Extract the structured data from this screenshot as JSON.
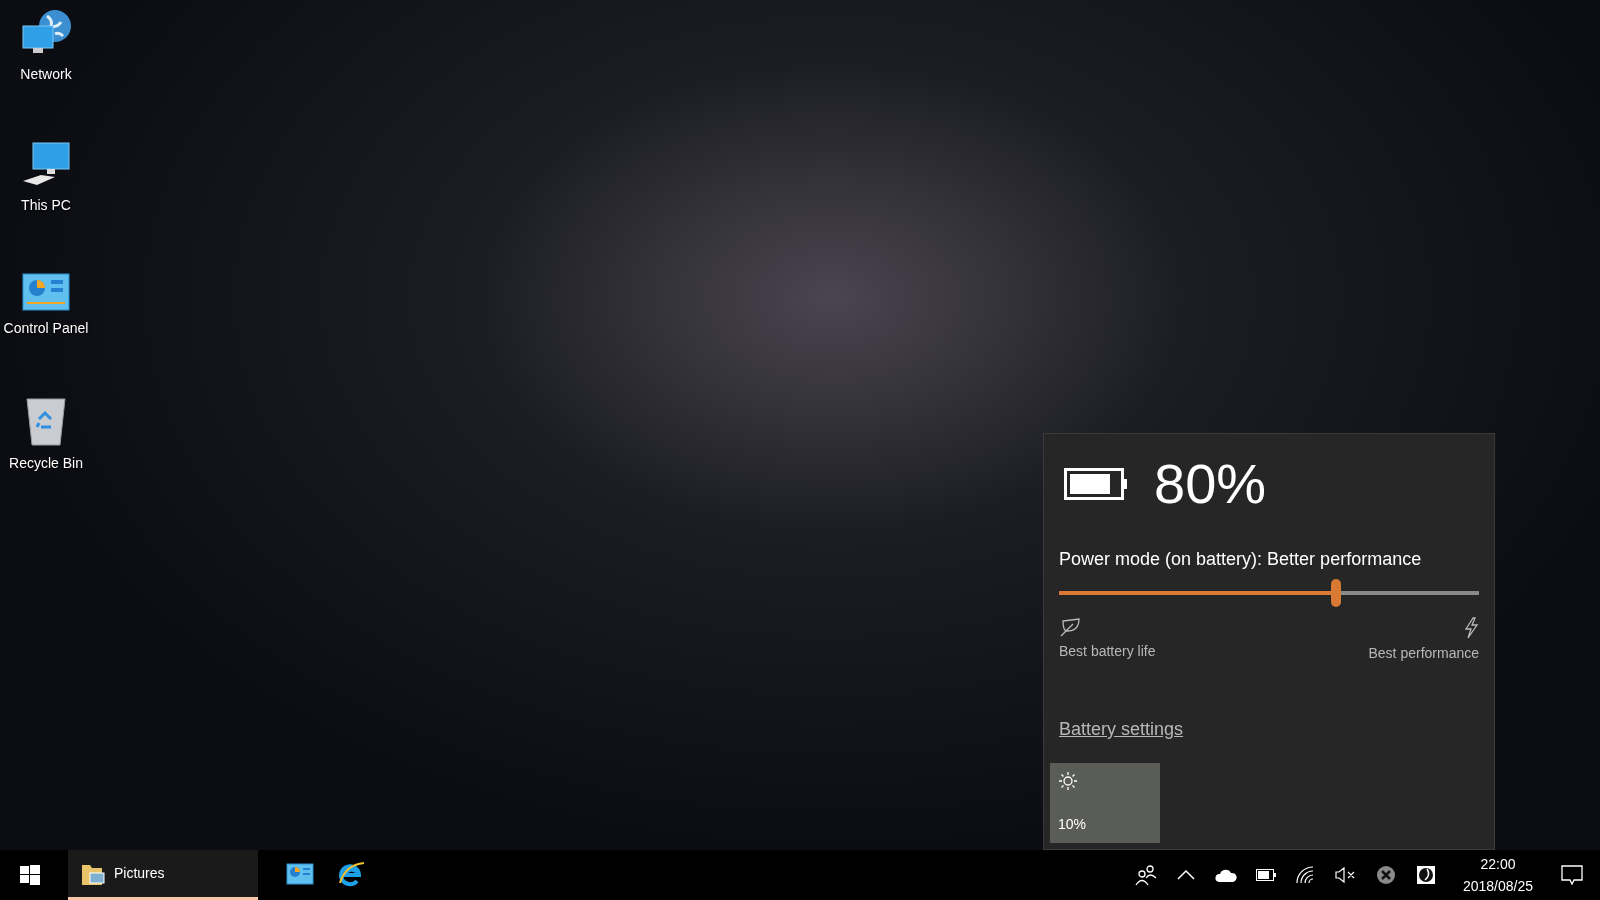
{
  "desktop_icons": [
    {
      "label": "Network",
      "kind": "network"
    },
    {
      "label": "This PC",
      "kind": "pc"
    },
    {
      "label": "Control Panel",
      "kind": "control-panel"
    },
    {
      "label": "Recycle Bin",
      "kind": "recycle-bin"
    }
  ],
  "battery_flyout": {
    "percent": "80%",
    "power_mode": "Power mode (on battery): Better performance",
    "slider": {
      "level": 0.66
    },
    "left_label": "Best battery life",
    "right_label": "Best performance",
    "link": "Battery settings",
    "quick_actions": [
      {
        "kind": "brightness",
        "label": "10%"
      }
    ]
  },
  "taskbar": {
    "apps": [
      {
        "kind": "folder",
        "label": "Pictures",
        "open": true
      },
      {
        "kind": "control-panel",
        "open": false
      },
      {
        "kind": "browser",
        "open": false
      }
    ],
    "clock": {
      "time": "22:00",
      "date": "2018/08/25"
    }
  }
}
